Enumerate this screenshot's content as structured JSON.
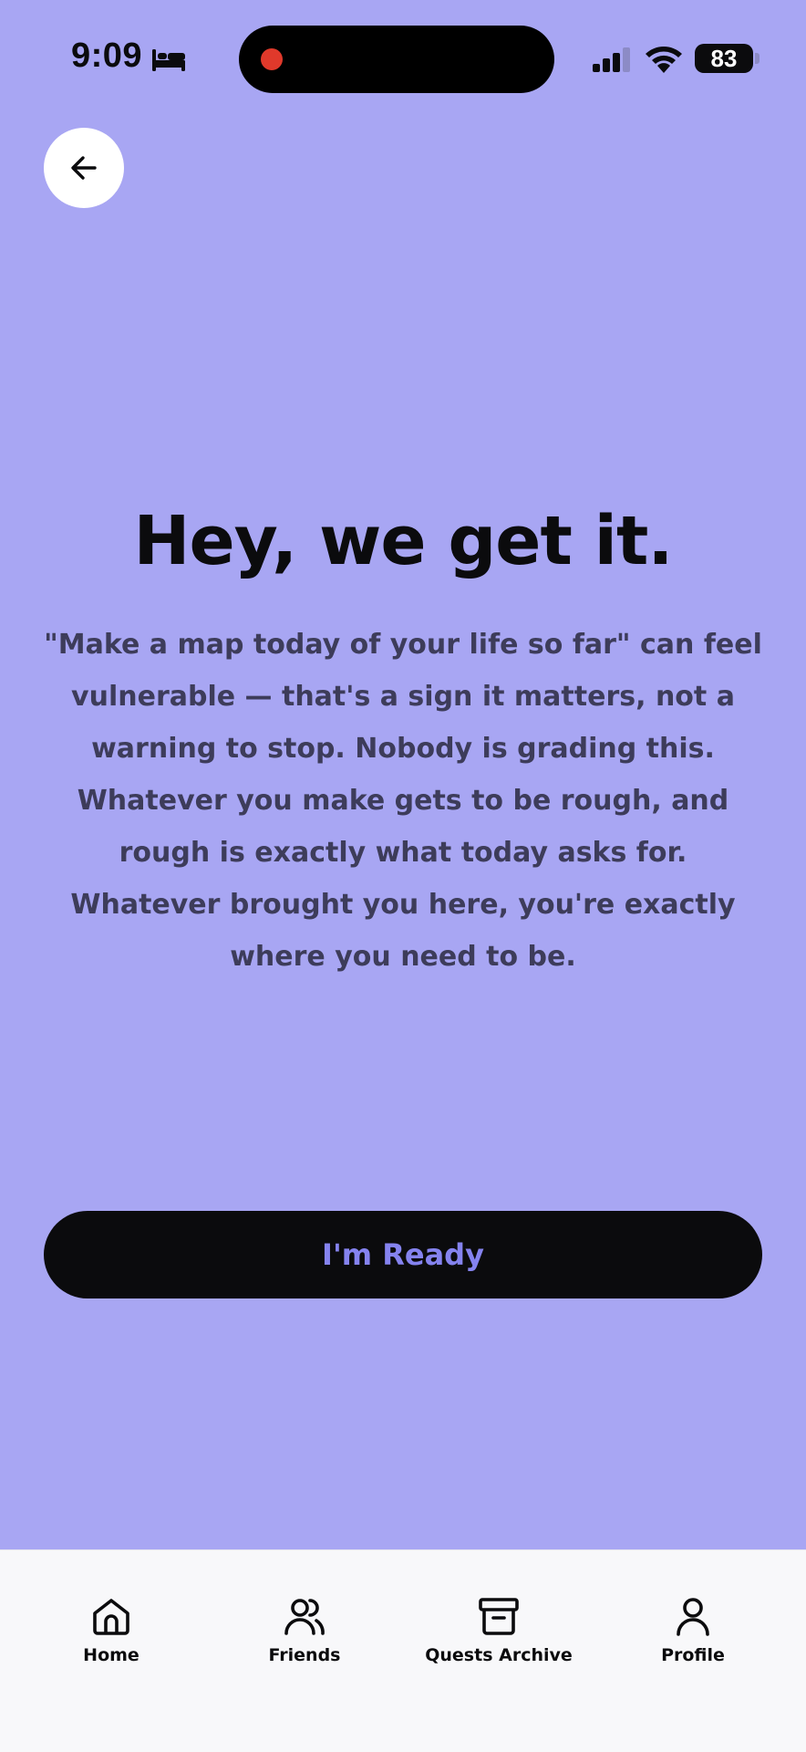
{
  "status_bar": {
    "time": "9:09",
    "battery": "83",
    "icons": [
      "bed-icon",
      "signal-icon",
      "wifi-icon",
      "battery-icon"
    ]
  },
  "header": {
    "back_icon": "arrow-left-icon"
  },
  "content": {
    "headline": "Hey, we get it.",
    "body": "\"Make a map today of your life so far\" can feel vulnerable — that's a sign it matters, not a warning to stop. Nobody is grading this. Whatever you make gets to be rough, and rough is exactly what today asks for. Whatever brought you here, you're exactly where you need to be."
  },
  "cta": {
    "label": "I'm Ready"
  },
  "tab_bar": {
    "items": [
      {
        "label": "Home",
        "icon": "home-icon"
      },
      {
        "label": "Friends",
        "icon": "friends-icon"
      },
      {
        "label": "Quests Archive",
        "icon": "archive-icon"
      },
      {
        "label": "Profile",
        "icon": "profile-icon"
      }
    ]
  },
  "colors": {
    "background": "#A8A6F3",
    "button_bg": "#0B0B0D",
    "button_text": "#8583EF",
    "tab_bar_bg": "#F8F8FA",
    "record_dot": "#E0392B"
  }
}
